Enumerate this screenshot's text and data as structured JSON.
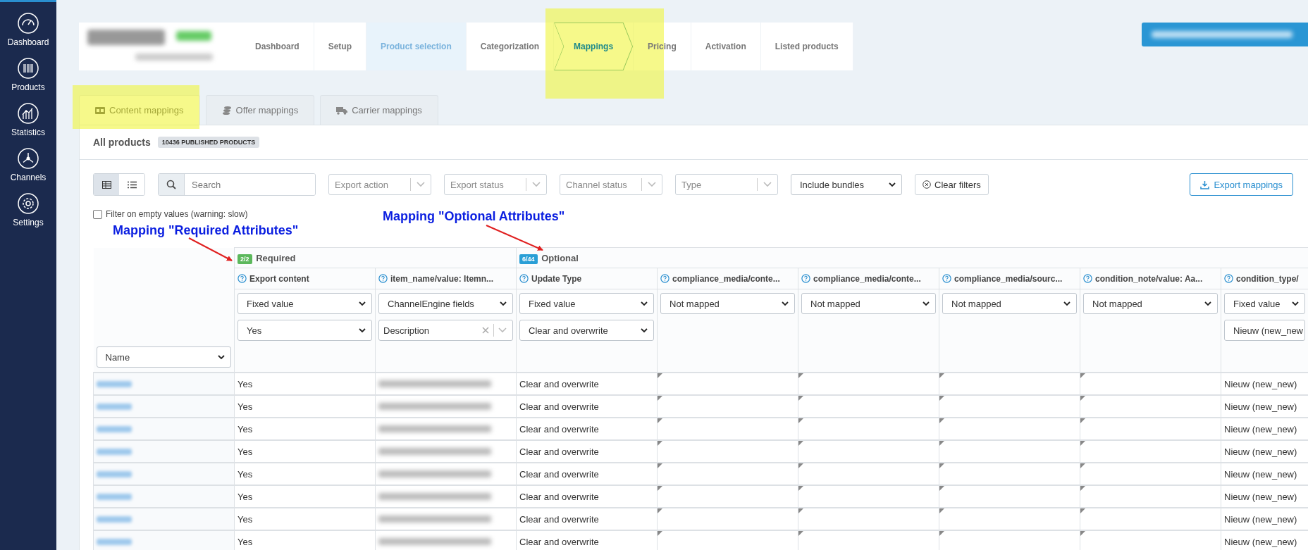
{
  "sidebar": {
    "items": [
      {
        "label": "Dashboard",
        "kind": "gauge"
      },
      {
        "label": "Products",
        "kind": "barcode"
      },
      {
        "label": "Statistics",
        "kind": "chart"
      },
      {
        "label": "Channels",
        "kind": "channels"
      },
      {
        "label": "Settings",
        "kind": "gear"
      }
    ]
  },
  "breadcrumbs": [
    {
      "label": "Dashboard",
      "selected": false,
      "highlighted": false
    },
    {
      "label": "Setup",
      "selected": false,
      "highlighted": false
    },
    {
      "label": "Product selection",
      "selected": false,
      "highlighted": true
    },
    {
      "label": "Categorization",
      "selected": false,
      "highlighted": false
    },
    {
      "label": "Mappings",
      "selected": true,
      "highlighted": false
    },
    {
      "label": "Pricing",
      "selected": false,
      "highlighted": false
    },
    {
      "label": "Activation",
      "selected": false,
      "highlighted": false
    },
    {
      "label": "Listed products",
      "selected": false,
      "highlighted": false
    }
  ],
  "tabs": [
    {
      "label": "Content mappings",
      "kind": "az",
      "selected": true
    },
    {
      "label": "Offer mappings",
      "kind": "coins",
      "selected": false
    },
    {
      "label": "Carrier mappings",
      "kind": "truck",
      "selected": false
    }
  ],
  "summary": {
    "title": "All products",
    "badge": "10436 PUBLISHED PRODUCTS"
  },
  "toolbar": {
    "view_toggle": [
      {
        "kind": "table",
        "selected": true
      },
      {
        "kind": "list",
        "selected": false
      }
    ],
    "search": {
      "placeholder": "Search"
    },
    "filters": [
      {
        "kind": "combo",
        "placeholder": "Export action"
      },
      {
        "kind": "combo",
        "placeholder": "Export status"
      },
      {
        "kind": "combo",
        "placeholder": "Channel status"
      },
      {
        "kind": "combo",
        "placeholder": "Type"
      },
      {
        "kind": "select",
        "value": "Include bundles"
      }
    ],
    "clear_filters": "Clear filters",
    "export_button": "Export mappings"
  },
  "empty_filter": {
    "label": "Filter on empty values (warning: slow)",
    "checked": false
  },
  "annotations": [
    "Mapping \"Required Attributes\"",
    "Mapping \"Optional Attributes\""
  ],
  "table": {
    "name_select": "Name",
    "groups": [
      {
        "badge": "2/2",
        "label": "Required",
        "color": "#5cb85c",
        "columns": [
          {
            "title": "Export content",
            "mappings": [
              {
                "kind": "select",
                "value": "Fixed value"
              },
              {
                "kind": "select",
                "value": "Yes"
              }
            ]
          },
          {
            "title": "item_name/value: Itemn...",
            "mappings": [
              {
                "kind": "select",
                "value": "ChannelEngine fields"
              },
              {
                "kind": "combo",
                "value": "Description"
              }
            ]
          }
        ]
      },
      {
        "badge": "6/44",
        "label": "Optional",
        "color": "#2a9fd6",
        "columns": [
          {
            "title": "Update Type",
            "mappings": [
              {
                "kind": "select",
                "value": "Fixed value"
              },
              {
                "kind": "select",
                "value": "Clear and overwrite"
              }
            ]
          },
          {
            "title": "compliance_media/conte...",
            "mappings": [
              {
                "kind": "select",
                "value": "Not mapped"
              }
            ]
          },
          {
            "title": "compliance_media/conte...",
            "mappings": [
              {
                "kind": "select",
                "value": "Not mapped"
              }
            ]
          },
          {
            "title": "compliance_media/sourc...",
            "mappings": [
              {
                "kind": "select",
                "value": "Not mapped"
              }
            ]
          },
          {
            "title": "condition_note/value: Aa...",
            "mappings": [
              {
                "kind": "select",
                "value": "Not mapped"
              }
            ]
          },
          {
            "title": "condition_type/",
            "mappings": [
              {
                "kind": "select",
                "value": "Fixed value"
              },
              {
                "kind": "select",
                "value": "Nieuw (new_new"
              }
            ]
          }
        ]
      }
    ],
    "rows": [
      {
        "cells": [
          {
            "kind": "blurred"
          },
          {
            "kind": "text",
            "value": "Yes"
          },
          {
            "kind": "blurred"
          },
          {
            "kind": "text",
            "value": "Clear and overwrite"
          },
          {
            "kind": "empty"
          },
          {
            "kind": "empty"
          },
          {
            "kind": "empty"
          },
          {
            "kind": "empty"
          },
          {
            "kind": "text",
            "value": "Nieuw (new_new)"
          }
        ]
      },
      {
        "cells": [
          {
            "kind": "blurred"
          },
          {
            "kind": "text",
            "value": "Yes"
          },
          {
            "kind": "blurred"
          },
          {
            "kind": "text",
            "value": "Clear and overwrite"
          },
          {
            "kind": "empty"
          },
          {
            "kind": "empty"
          },
          {
            "kind": "empty"
          },
          {
            "kind": "empty"
          },
          {
            "kind": "text",
            "value": "Nieuw (new_new)"
          }
        ]
      },
      {
        "cells": [
          {
            "kind": "blurred"
          },
          {
            "kind": "text",
            "value": "Yes"
          },
          {
            "kind": "blurred"
          },
          {
            "kind": "text",
            "value": "Clear and overwrite"
          },
          {
            "kind": "empty"
          },
          {
            "kind": "empty"
          },
          {
            "kind": "empty"
          },
          {
            "kind": "empty"
          },
          {
            "kind": "text",
            "value": "Nieuw (new_new)"
          }
        ]
      },
      {
        "cells": [
          {
            "kind": "blurred"
          },
          {
            "kind": "text",
            "value": "Yes"
          },
          {
            "kind": "blurred"
          },
          {
            "kind": "text",
            "value": "Clear and overwrite"
          },
          {
            "kind": "empty"
          },
          {
            "kind": "empty"
          },
          {
            "kind": "empty"
          },
          {
            "kind": "empty"
          },
          {
            "kind": "text",
            "value": "Nieuw (new_new)"
          }
        ]
      },
      {
        "cells": [
          {
            "kind": "blurred"
          },
          {
            "kind": "text",
            "value": "Yes"
          },
          {
            "kind": "blurred"
          },
          {
            "kind": "text",
            "value": "Clear and overwrite"
          },
          {
            "kind": "empty"
          },
          {
            "kind": "empty"
          },
          {
            "kind": "empty"
          },
          {
            "kind": "empty"
          },
          {
            "kind": "text",
            "value": "Nieuw (new_new)"
          }
        ]
      },
      {
        "cells": [
          {
            "kind": "blurred"
          },
          {
            "kind": "text",
            "value": "Yes"
          },
          {
            "kind": "blurred"
          },
          {
            "kind": "text",
            "value": "Clear and overwrite"
          },
          {
            "kind": "empty"
          },
          {
            "kind": "empty"
          },
          {
            "kind": "empty"
          },
          {
            "kind": "empty"
          },
          {
            "kind": "text",
            "value": "Nieuw (new_new)"
          }
        ]
      },
      {
        "cells": [
          {
            "kind": "blurred"
          },
          {
            "kind": "text",
            "value": "Yes"
          },
          {
            "kind": "blurred"
          },
          {
            "kind": "text",
            "value": "Clear and overwrite"
          },
          {
            "kind": "empty"
          },
          {
            "kind": "empty"
          },
          {
            "kind": "empty"
          },
          {
            "kind": "empty"
          },
          {
            "kind": "text",
            "value": "Nieuw (new_new)"
          }
        ]
      },
      {
        "cells": [
          {
            "kind": "blurred"
          },
          {
            "kind": "text",
            "value": "Yes"
          },
          {
            "kind": "blurred"
          },
          {
            "kind": "text",
            "value": "Clear and overwrite"
          },
          {
            "kind": "empty"
          },
          {
            "kind": "empty"
          },
          {
            "kind": "empty"
          },
          {
            "kind": "empty"
          },
          {
            "kind": "text",
            "value": "Nieuw (new_new)"
          }
        ]
      }
    ]
  }
}
